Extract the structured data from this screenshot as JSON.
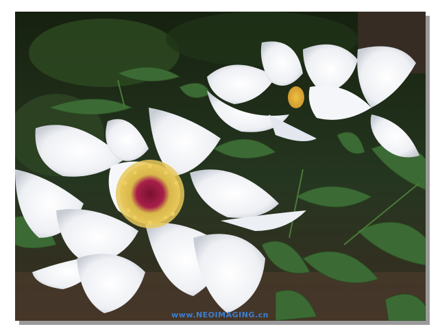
{
  "image": {
    "subject": "peony-photo"
  },
  "watermark": {
    "text": "www.NEOIMAGING.cn"
  }
}
